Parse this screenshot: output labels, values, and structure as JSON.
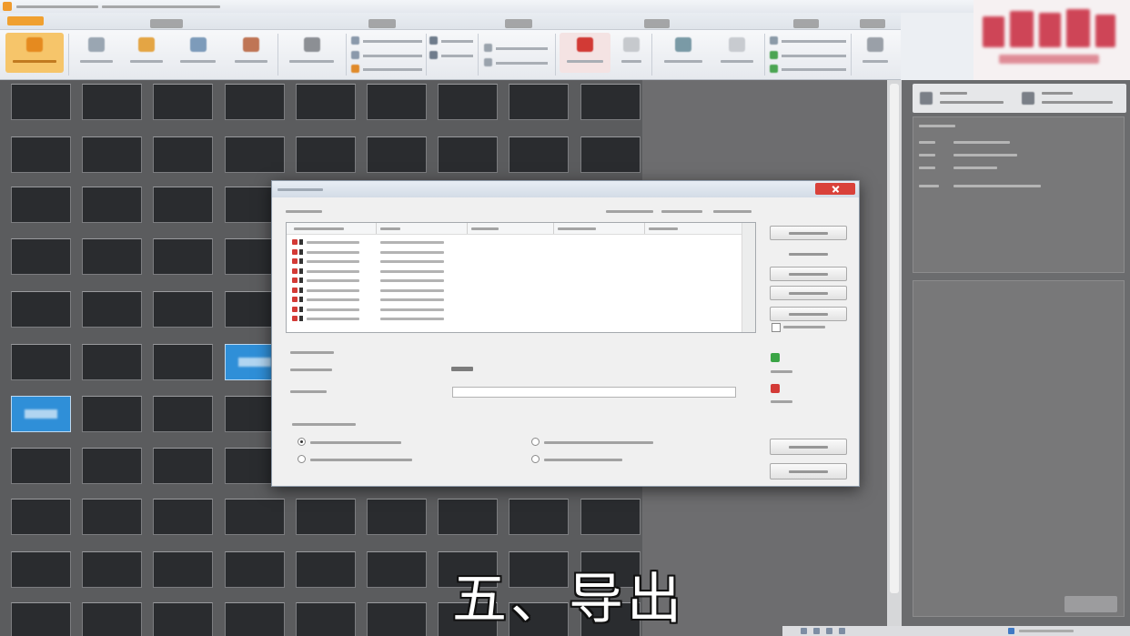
{
  "subtitle": "五、导出",
  "colors": {
    "grid_background": "#5b5c5e",
    "tile": "#2a2c2f",
    "selected_tile": "#2f8fd8",
    "dialog_close": "#d9413a",
    "logo": "#c8283c",
    "status_ok": "#3aa445",
    "status_error": "#d33a36"
  },
  "icons": {
    "app": "app-icon",
    "close": "close-icon",
    "record": "record-icon",
    "ok_status": "green-status-icon",
    "error_status": "red-status-icon"
  }
}
